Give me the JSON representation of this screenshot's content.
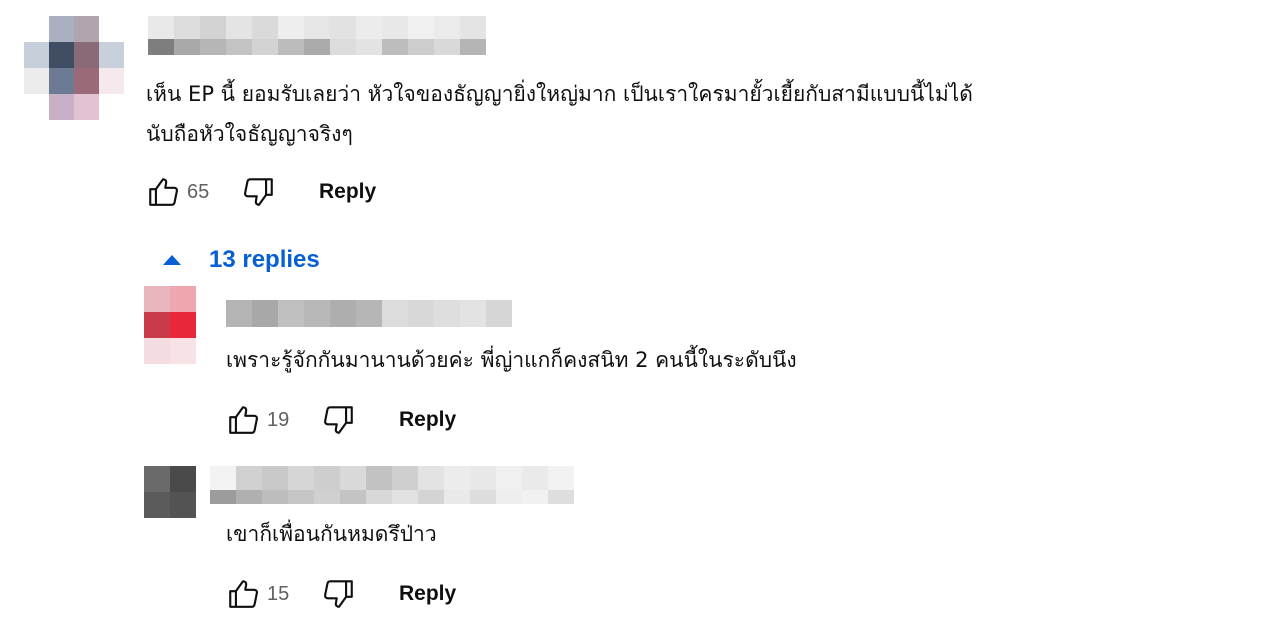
{
  "comment": {
    "text_lines": [
      "เห็น EP นี้ ยอมรับเลยว่า หัวใจของธัญญายิ่งใหญ่มาก เป็นเราใครมายั้วเยี้ยกับสามีแบบนี้ไม่ได้",
      "นับถือหัวใจธัญญาจริงๆ"
    ],
    "like_count": "65",
    "reply_label": "Reply"
  },
  "replies_toggle": {
    "icon": "caret-up-icon",
    "label": "13 replies"
  },
  "replies": [
    {
      "text": "เพราะรู้จักกันมานานด้วยค่ะ พี่ญ่าแกก็คงสนิท 2 คนนี้ในระดับนึง",
      "like_count": "19",
      "reply_label": "Reply"
    },
    {
      "text": "เขาก็เพื่อนกันหมดรึป่าว",
      "like_count": "15",
      "reply_label": "Reply"
    }
  ],
  "icons": {
    "like": "thumbs-up-icon",
    "dislike": "thumbs-down-icon"
  },
  "colors": {
    "accent": "#065fd4",
    "text": "#0f0f0f",
    "secondary": "#606060"
  }
}
